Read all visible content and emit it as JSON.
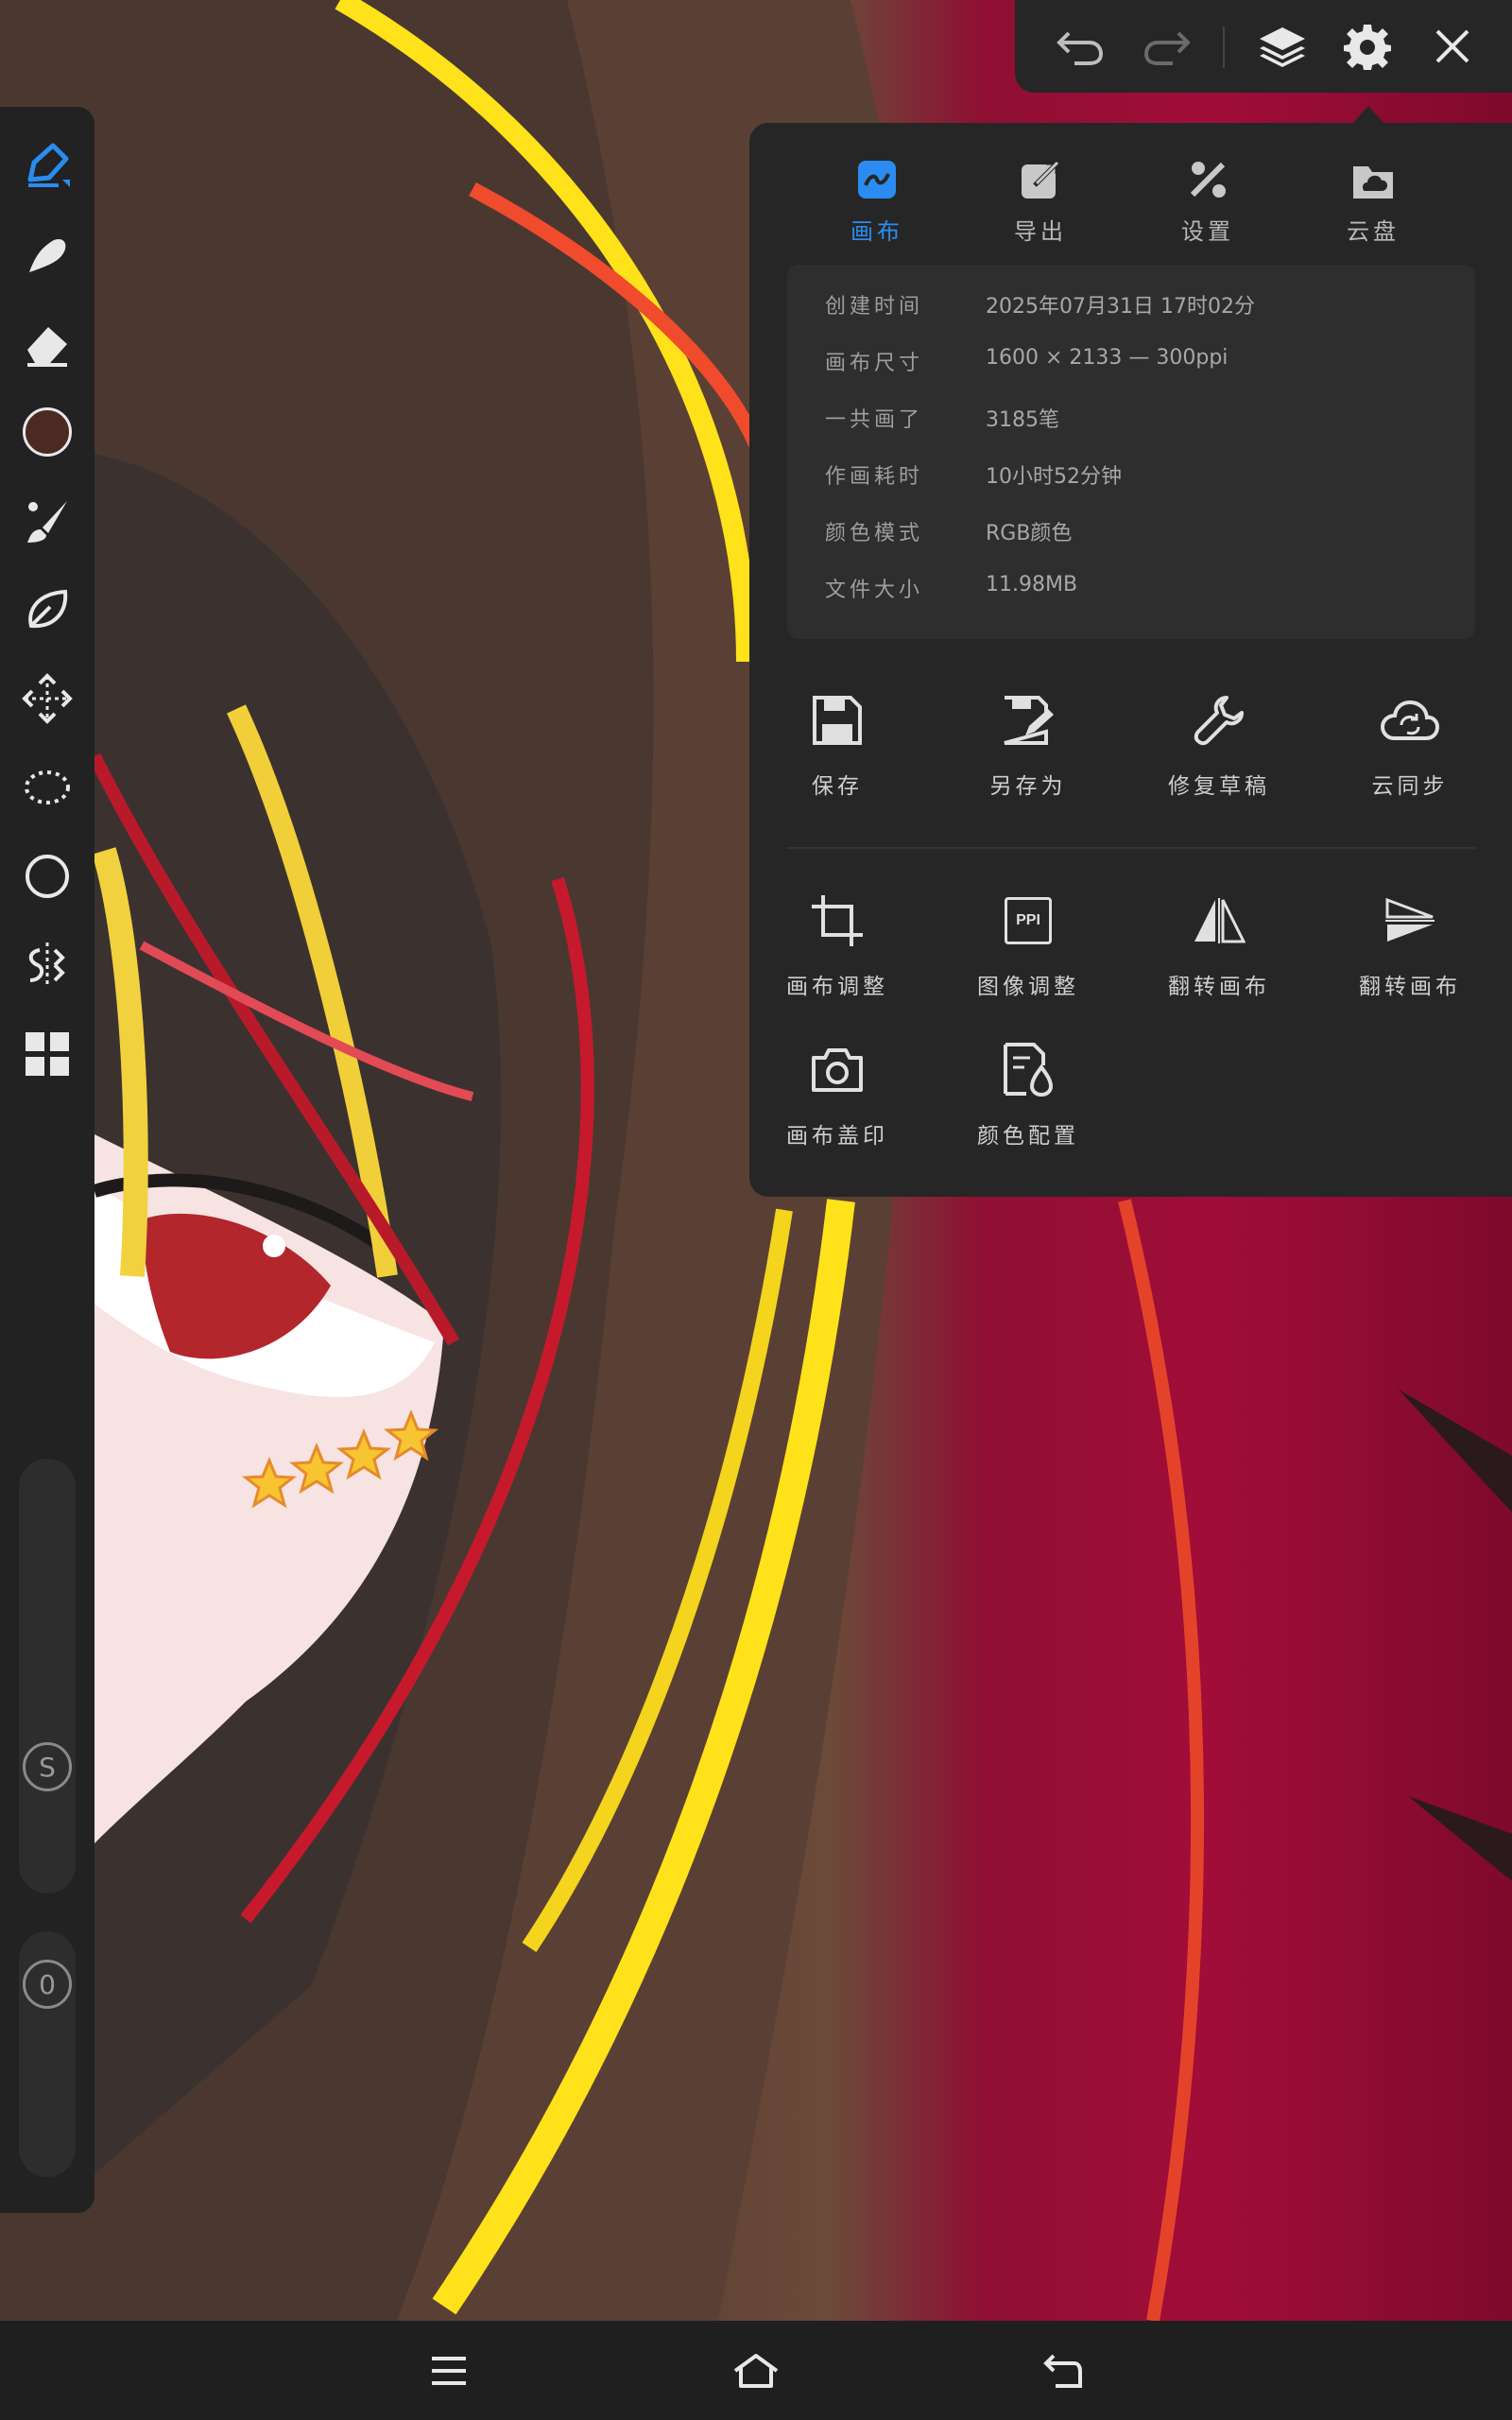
{
  "colors": {
    "panel_bg": "#262626",
    "accent": "#2a8cf0",
    "current_color": "#4a2a22",
    "canvas_red": "#9a0c36"
  },
  "top_toolbar": {
    "undo_icon": "undo-icon",
    "redo_icon": "redo-icon",
    "layers_icon": "layers-icon",
    "settings_icon": "gear-icon",
    "close_icon": "close-icon"
  },
  "left_toolbar": {
    "tools": [
      "brush-pen",
      "smudge",
      "eraser",
      "color",
      "paint-brush",
      "lasso-fill",
      "move",
      "selection",
      "shape",
      "symmetry",
      "grid-menu"
    ],
    "size_badge": "S",
    "opacity_badge": "0"
  },
  "panel": {
    "tabs": [
      {
        "label": "画布",
        "icon": "canvas-icon"
      },
      {
        "label": "导出",
        "icon": "export-icon"
      },
      {
        "label": "设置",
        "icon": "tools-icon"
      },
      {
        "label": "云盘",
        "icon": "cloud-drive-icon"
      }
    ],
    "info": [
      {
        "key": "创建时间",
        "value": "2025年07月31日 17时02分"
      },
      {
        "key": "画布尺寸",
        "value": "1600 × 2133 — 300ppi"
      },
      {
        "key": "一共画了",
        "value": "3185笔"
      },
      {
        "key": "作画耗时",
        "value": "10小时52分钟"
      },
      {
        "key": "颜色模式",
        "value": "RGB颜色"
      },
      {
        "key": "文件大小",
        "value": "11.98MB"
      }
    ],
    "actions_row1": [
      {
        "label": "保存",
        "icon": "save-icon"
      },
      {
        "label": "另存为",
        "icon": "save-as-icon"
      },
      {
        "label": "修复草稿",
        "icon": "wrench-icon"
      },
      {
        "label": "云同步",
        "icon": "cloud-sync-icon"
      }
    ],
    "actions_row2": [
      {
        "label": "画布调整",
        "icon": "crop-icon"
      },
      {
        "label": "图像调整",
        "icon": "ppi-icon",
        "icon_text": "PPI"
      },
      {
        "label": "翻转画布",
        "icon": "flip-horizontal-icon"
      },
      {
        "label": "翻转画布",
        "icon": "flip-vertical-icon"
      }
    ],
    "actions_row3": [
      {
        "label": "画布盖印",
        "icon": "camera-icon"
      },
      {
        "label": "颜色配置",
        "icon": "color-profile-icon"
      }
    ]
  },
  "navbar": {
    "menu_icon": "menu-icon",
    "home_icon": "home-icon",
    "back_icon": "back-icon"
  }
}
